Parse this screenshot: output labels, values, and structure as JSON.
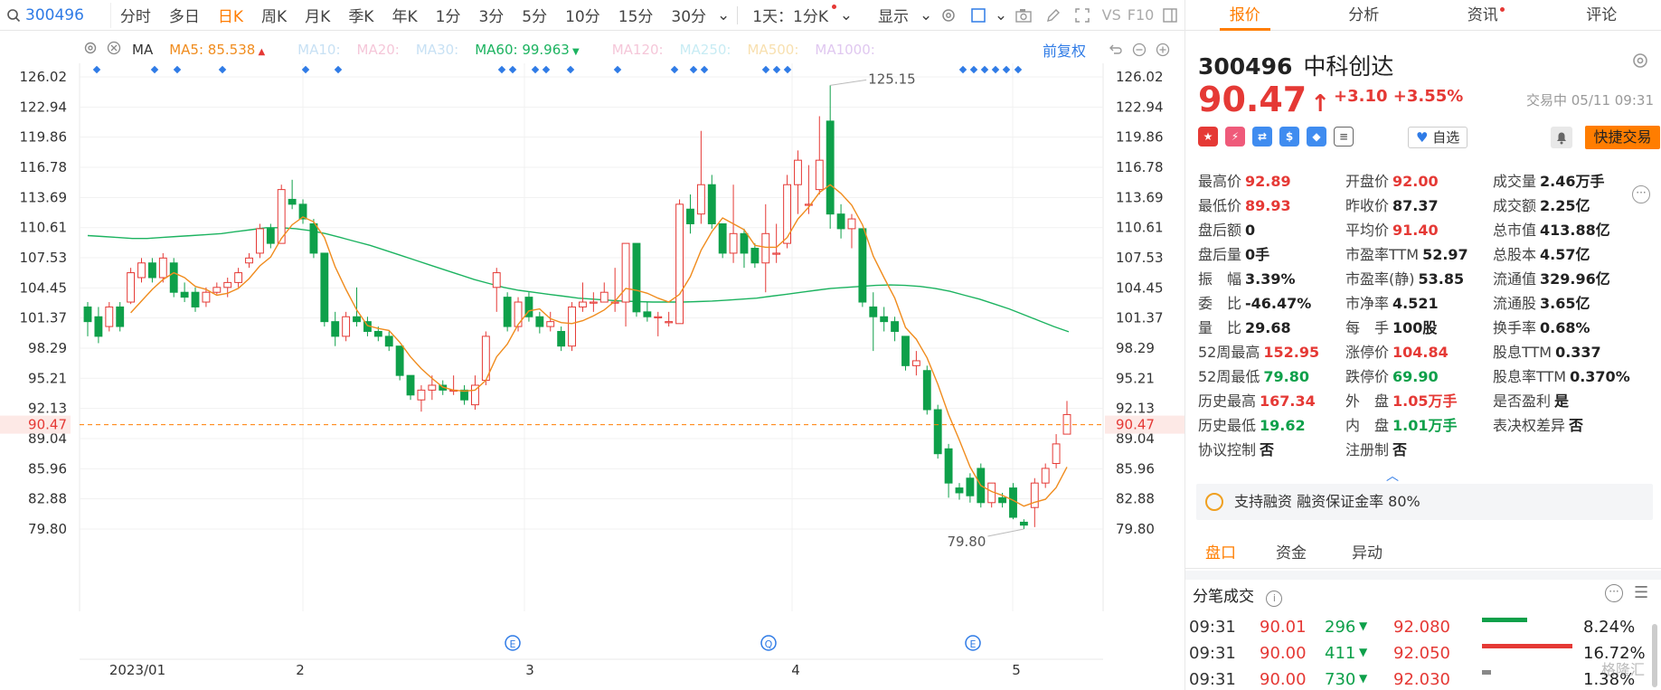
{
  "toolbar": {
    "code": "300496",
    "periods": [
      "分时",
      "多日",
      "日K",
      "周K",
      "月K",
      "季K",
      "年K",
      "1分",
      "3分",
      "5分",
      "10分",
      "15分",
      "30分"
    ],
    "active": "日K",
    "span_select": "1天：1分K",
    "display": "显示"
  },
  "indicators": {
    "ma_label": "MA",
    "ma5": "MA5:",
    "ma5_val": "85.538",
    "ma10": "MA10:",
    "ma20": "MA20:",
    "ma30": "MA30:",
    "ma60": "MA60:",
    "ma60_val": "99.963",
    "ma120": "MA120:",
    "ma250": "MA250:",
    "ma500": "MA500:",
    "ma1000": "MA1000:",
    "fuquan": "前复权",
    "colors": {
      "ma5": "#f08c1e",
      "ma60": "#1cb360",
      "faded": "#c8e1f4"
    }
  },
  "chart_data": {
    "type": "candlestick",
    "y_ticks": [
      "126.02",
      "122.94",
      "119.86",
      "116.78",
      "113.69",
      "110.61",
      "107.53",
      "104.45",
      "101.37",
      "98.29",
      "95.21",
      "92.13",
      "89.04",
      "85.96",
      "82.88",
      "79.80"
    ],
    "x_labels": [
      "2023/01",
      "2",
      "3",
      "4",
      "5"
    ],
    "last_price": "90.47",
    "high_mark": "125.15",
    "low_mark": "79.80",
    "event_markers": [
      "E",
      "Q",
      "E"
    ],
    "colors": {
      "up": "#e53935",
      "down": "#0ea04a"
    },
    "candles": [
      [
        102.5,
        101,
        103,
        99.5
      ],
      [
        101.5,
        99.5,
        102.5,
        98.8
      ],
      [
        100.5,
        102.5,
        103,
        100
      ],
      [
        102.5,
        100.5,
        103,
        100
      ],
      [
        103,
        106,
        106.5,
        102.8
      ],
      [
        105.5,
        107,
        107.5,
        105
      ],
      [
        107,
        105.5,
        107.5,
        105
      ],
      [
        105.5,
        107.5,
        108,
        105
      ],
      [
        107,
        104,
        107.5,
        103.5
      ],
      [
        104,
        103.5,
        105,
        103
      ],
      [
        104,
        102.5,
        104.5,
        102
      ],
      [
        103,
        104,
        104.5,
        102.5
      ],
      [
        104,
        104.5,
        105,
        103.8
      ],
      [
        104.5,
        105,
        105.5,
        103.5
      ],
      [
        105,
        106,
        106.5,
        104.5
      ],
      [
        107,
        107.5,
        108,
        106.5
      ],
      [
        108,
        110.5,
        111,
        107.5
      ],
      [
        110.5,
        109,
        111,
        108.5
      ],
      [
        109,
        114.5,
        115,
        109
      ],
      [
        113.5,
        113,
        115.5,
        112.5
      ],
      [
        113,
        111.5,
        113.5,
        111
      ],
      [
        111,
        108,
        111.5,
        107.5
      ],
      [
        108,
        101,
        108,
        100.5
      ],
      [
        101,
        99.5,
        102,
        98.5
      ],
      [
        99.5,
        101.5,
        102,
        99
      ],
      [
        101.5,
        101,
        104.5,
        100.5
      ],
      [
        101,
        100,
        101.5,
        99.5
      ],
      [
        100,
        99.5,
        100.5,
        99
      ],
      [
        99.5,
        98.5,
        100,
        98
      ],
      [
        98.5,
        95.5,
        98.5,
        95
      ],
      [
        95.5,
        93.5,
        95.5,
        93
      ],
      [
        93,
        94,
        94.5,
        91.8
      ],
      [
        94,
        94.5,
        95.5,
        93
      ],
      [
        94.5,
        94,
        95,
        93.5
      ],
      [
        94,
        94,
        95.5,
        93.5
      ],
      [
        94,
        93,
        94.5,
        92.5
      ],
      [
        92.5,
        94.5,
        95.5,
        92
      ],
      [
        95,
        99.5,
        100,
        94.5
      ],
      [
        104.5,
        106,
        106.5,
        102
      ],
      [
        103.5,
        100.5,
        104,
        100
      ],
      [
        100.5,
        103,
        103.5,
        100
      ],
      [
        103.5,
        101.5,
        104,
        101
      ],
      [
        101.5,
        100.5,
        102,
        99.8
      ],
      [
        100.5,
        101,
        102,
        100
      ],
      [
        100,
        98.5,
        100.5,
        98
      ],
      [
        98.5,
        102.5,
        103,
        98
      ],
      [
        102.5,
        103,
        105,
        102
      ],
      [
        103,
        103,
        104,
        102
      ],
      [
        103,
        104,
        105,
        103
      ],
      [
        103,
        103,
        106.5,
        102
      ],
      [
        103,
        109,
        109,
        100.5
      ],
      [
        109,
        102,
        109,
        101.5
      ],
      [
        102,
        101.5,
        103,
        101
      ],
      [
        101.5,
        101.5,
        102,
        99.5
      ],
      [
        101,
        101,
        102,
        100.5
      ],
      [
        100.8,
        113,
        113.5,
        100.8
      ],
      [
        112.5,
        111,
        114,
        110
      ],
      [
        112,
        115,
        120.5,
        111
      ],
      [
        115,
        111,
        116,
        110.5
      ],
      [
        111,
        108,
        111,
        107.5
      ],
      [
        108,
        110,
        115,
        107
      ],
      [
        110,
        108,
        110.5,
        106.5
      ],
      [
        108.5,
        107,
        109,
        106.5
      ],
      [
        107,
        110,
        113,
        104
      ],
      [
        108,
        108,
        111,
        107
      ],
      [
        109,
        115,
        116,
        108.5
      ],
      [
        115,
        117.5,
        118.5,
        112
      ],
      [
        113,
        113,
        117,
        112
      ],
      [
        114.5,
        117.5,
        122,
        114
      ],
      [
        121.5,
        112,
        125.15,
        110.5
      ],
      [
        112,
        110.5,
        113,
        109.5
      ],
      [
        110.5,
        111.5,
        112,
        108.5
      ],
      [
        110.5,
        103,
        110.5,
        102.5
      ],
      [
        102.5,
        101.5,
        104,
        98
      ],
      [
        101.5,
        101,
        102.5,
        100
      ],
      [
        101,
        100,
        101.5,
        99
      ],
      [
        99.5,
        96.5,
        99.5,
        96
      ],
      [
        96.5,
        97,
        98,
        95.5
      ],
      [
        96,
        92,
        96.5,
        91.5
      ],
      [
        92,
        87.5,
        92.5,
        87
      ],
      [
        88,
        84.5,
        88.5,
        83
      ],
      [
        84,
        83.5,
        84.5,
        82.8
      ],
      [
        85,
        83.2,
        85.5,
        82.5
      ],
      [
        86,
        82.5,
        86.5,
        82
      ],
      [
        82.5,
        84.5,
        84.5,
        82
      ],
      [
        83,
        82.5,
        83.5,
        82
      ],
      [
        84,
        81,
        84.5,
        80.8
      ],
      [
        80.5,
        80.2,
        80.8,
        79.8
      ],
      [
        82,
        84.5,
        85,
        80
      ],
      [
        84.5,
        86,
        86.5,
        84
      ],
      [
        86.5,
        88.5,
        89.5,
        86
      ],
      [
        89.5,
        91.5,
        92.89,
        89.93
      ]
    ]
  },
  "quote": {
    "tabs": [
      "报价",
      "分析",
      "资讯",
      "评论"
    ],
    "code": "300496",
    "name": "中科创达",
    "price": "90.47",
    "change": "+3.10",
    "pct": "+3.55%",
    "status": "交易中 05/11 09:31",
    "zixuan": "自选",
    "quick": "快捷交易",
    "rows": [
      [
        [
          "最高价",
          "92.89",
          "red"
        ],
        [
          "开盘价",
          "92.00",
          "red"
        ],
        [
          "成交量",
          "2.46万手",
          "dark"
        ]
      ],
      [
        [
          "最低价",
          "89.93",
          "red"
        ],
        [
          "昨收价",
          "87.37",
          "dark"
        ],
        [
          "成交额",
          "2.25亿",
          "dark"
        ]
      ],
      [
        [
          "盘后额",
          "0",
          "dark"
        ],
        [
          "平均价",
          "91.40",
          "red"
        ],
        [
          "总市值",
          "413.88亿",
          "dark"
        ]
      ],
      [
        [
          "盘后量",
          "0手",
          "dark"
        ],
        [
          "市盈率TTM",
          "52.97",
          "dark"
        ],
        [
          "总股本",
          "4.57亿",
          "dark"
        ]
      ],
      [
        [
          "振　幅",
          "3.39%",
          "dark"
        ],
        [
          "市盈率(静)",
          "53.85",
          "dark"
        ],
        [
          "流通值",
          "329.96亿",
          "dark"
        ]
      ],
      [
        [
          "委　比",
          "-46.47%",
          "dark"
        ],
        [
          "市净率",
          "4.521",
          "dark"
        ],
        [
          "流通股",
          "3.65亿",
          "dark"
        ]
      ],
      [
        [
          "量　比",
          "29.68",
          "dark"
        ],
        [
          "每　手",
          "100股",
          "dark"
        ],
        [
          "换手率",
          "0.68%",
          "dark"
        ]
      ],
      [
        [
          "52周最高",
          "152.95",
          "red"
        ],
        [
          "涨停价",
          "104.84",
          "red"
        ],
        [
          "股息TTM",
          "0.337",
          "dark"
        ]
      ],
      [
        [
          "52周最低",
          "79.80",
          "green"
        ],
        [
          "跌停价",
          "69.90",
          "green"
        ],
        [
          "股息率TTM",
          "0.370%",
          "dark"
        ]
      ],
      [
        [
          "历史最高",
          "167.34",
          "red"
        ],
        [
          "外　盘",
          "1.05万手",
          "red"
        ],
        [
          "是否盈利",
          "是",
          "dark"
        ]
      ],
      [
        [
          "历史最低",
          "19.62",
          "green"
        ],
        [
          "内　盘",
          "1.01万手",
          "green"
        ],
        [
          "表决权差异",
          "否",
          "dark"
        ]
      ],
      [
        [
          "协议控制",
          "否",
          "dark"
        ],
        [
          "注册制",
          "否",
          "dark"
        ],
        null
      ]
    ],
    "rzrq": "支持融资  融资保证金率 80%",
    "tabs2": [
      "盘口",
      "资金",
      "异动"
    ],
    "fenbi": "分笔成交",
    "trades": [
      {
        "time": "09:31",
        "price": "90.01",
        "vol": "296",
        "pr2": "92.080",
        "pct": "8.24%",
        "w": 0.5,
        "c": "#0ea04a"
      },
      {
        "time": "09:31",
        "price": "90.00",
        "vol": "411",
        "pr2": "92.050",
        "pct": "16.72%",
        "w": 1.0,
        "c": "#e53935"
      },
      {
        "time": "09:31",
        "price": "90.00",
        "vol": "730",
        "pr2": "92.030",
        "pct": "1.38%",
        "w": 0.1,
        "c": "#888"
      }
    ],
    "watermark": "格隆汇"
  }
}
